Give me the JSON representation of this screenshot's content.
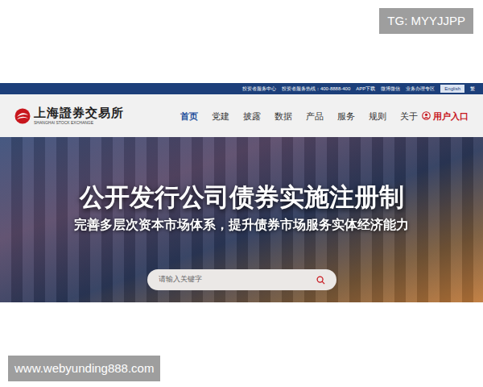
{
  "watermarks": {
    "top": "TG: MYYJJPP",
    "bottom": "www.webyunding888.com"
  },
  "topbar": {
    "links": [
      "投资者服务中心",
      "投资者服务热线：400-8888-400",
      "APP下载",
      "微博微信",
      "业务办理专区"
    ],
    "language": {
      "label": "English",
      "selected": true
    },
    "traditional": "繁"
  },
  "logo": {
    "name": "上海證券交易所",
    "subtitle": "SHANGHAI STOCK EXCHANGE"
  },
  "nav": [
    {
      "label": "首页",
      "selected": true
    },
    {
      "label": "党建",
      "selected": false
    },
    {
      "label": "披露",
      "selected": false
    },
    {
      "label": "数据",
      "selected": false
    },
    {
      "label": "产品",
      "selected": false
    },
    {
      "label": "服务",
      "selected": false
    },
    {
      "label": "规则",
      "selected": false
    },
    {
      "label": "关于",
      "selected": false
    }
  ],
  "user_entry": "用户入口",
  "banner": {
    "title": "公开发行公司债券实施注册制",
    "subtitle": "完善多层次资本市场体系，提升债券市场服务实体经济能力"
  },
  "search": {
    "placeholder": "请输入关键字"
  }
}
